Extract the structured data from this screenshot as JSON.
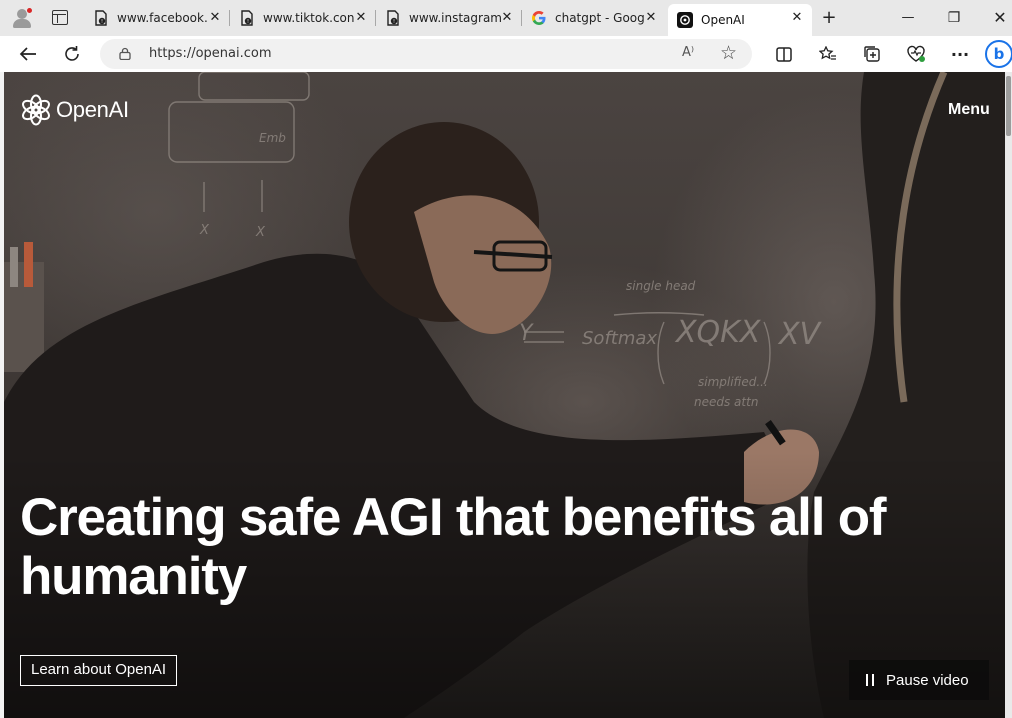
{
  "browser": {
    "tabs": [
      {
        "title": "www.facebook.",
        "icon": "page-warning-icon"
      },
      {
        "title": "www.tiktok.con",
        "icon": "page-warning-icon"
      },
      {
        "title": "www.instagram",
        "icon": "page-warning-icon"
      },
      {
        "title": "chatgpt - Goog",
        "icon": "google-icon"
      },
      {
        "title": "OpenAI",
        "icon": "openai-icon",
        "active": true
      }
    ],
    "close_glyph": "✕",
    "new_tab_glyph": "+",
    "window": {
      "minimize": "—",
      "restore": "❐",
      "close": "✕"
    },
    "address": {
      "url": "https://openai.com",
      "read_aloud": "A⁾"
    },
    "more_glyph": "···",
    "bing_label": "b"
  },
  "page": {
    "brand": "OpenAI",
    "menu_label": "Menu",
    "headline": "Creating safe AGI that benefits all of humanity",
    "cta_label": "Learn about OpenAI",
    "pause_label": "Pause video",
    "colors": {
      "text": "#ffffff",
      "hero_dark": "#3f3936"
    }
  }
}
